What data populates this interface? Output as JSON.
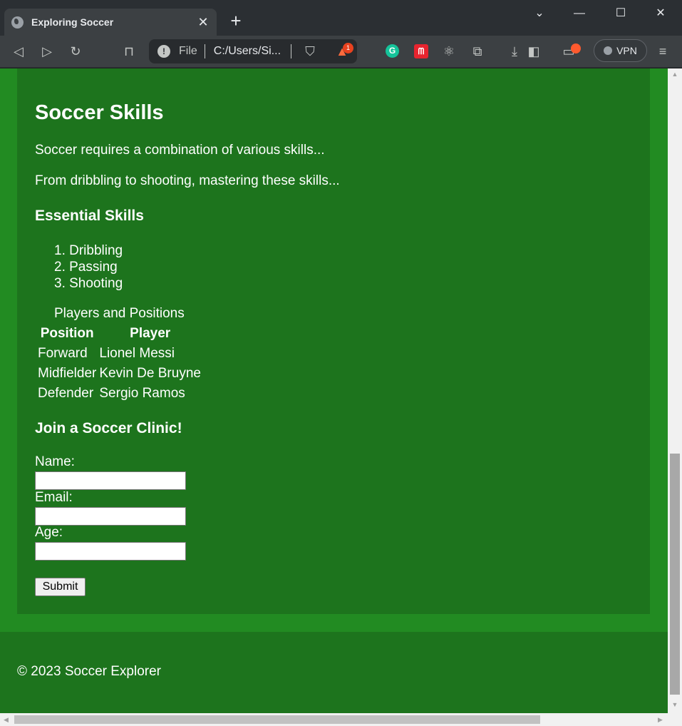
{
  "browser": {
    "tab_title": "Exploring Soccer",
    "tab_close": "✕",
    "new_tab": "+",
    "window_controls": {
      "minimize": "—",
      "maximize": "☐",
      "close": "✕",
      "tab_search": "⌄"
    },
    "url_scheme_label": "File",
    "url": "C:/Users/Si...",
    "vpn_label": "VPN",
    "rewards_count": "1",
    "grammarly_letter": "G"
  },
  "page": {
    "heading": "Soccer Skills",
    "paragraph1": "Soccer requires a combination of various skills...",
    "paragraph2": "From dribbling to shooting, mastering these skills...",
    "essential_heading": "Essential Skills",
    "skills": [
      "1. Dribbling",
      "2. Passing",
      "3. Shooting"
    ],
    "table": {
      "caption": "Players and Positions",
      "headers": [
        "Position",
        "Player"
      ],
      "rows": [
        [
          "Forward",
          "Lionel Messi"
        ],
        [
          "Midfielder",
          "Kevin De Bruyne"
        ],
        [
          "Defender",
          "Sergio Ramos"
        ]
      ]
    },
    "clinic_heading": "Join a Soccer Clinic!",
    "form": {
      "name_label": "Name:",
      "email_label": "Email:",
      "age_label": "Age:",
      "name_value": "",
      "email_value": "",
      "age_value": "",
      "submit_label": "Submit"
    },
    "footer": "© 2023 Soccer Explorer"
  },
  "colors": {
    "page_bg": "#228b22",
    "content_bg": "#1d741d"
  }
}
